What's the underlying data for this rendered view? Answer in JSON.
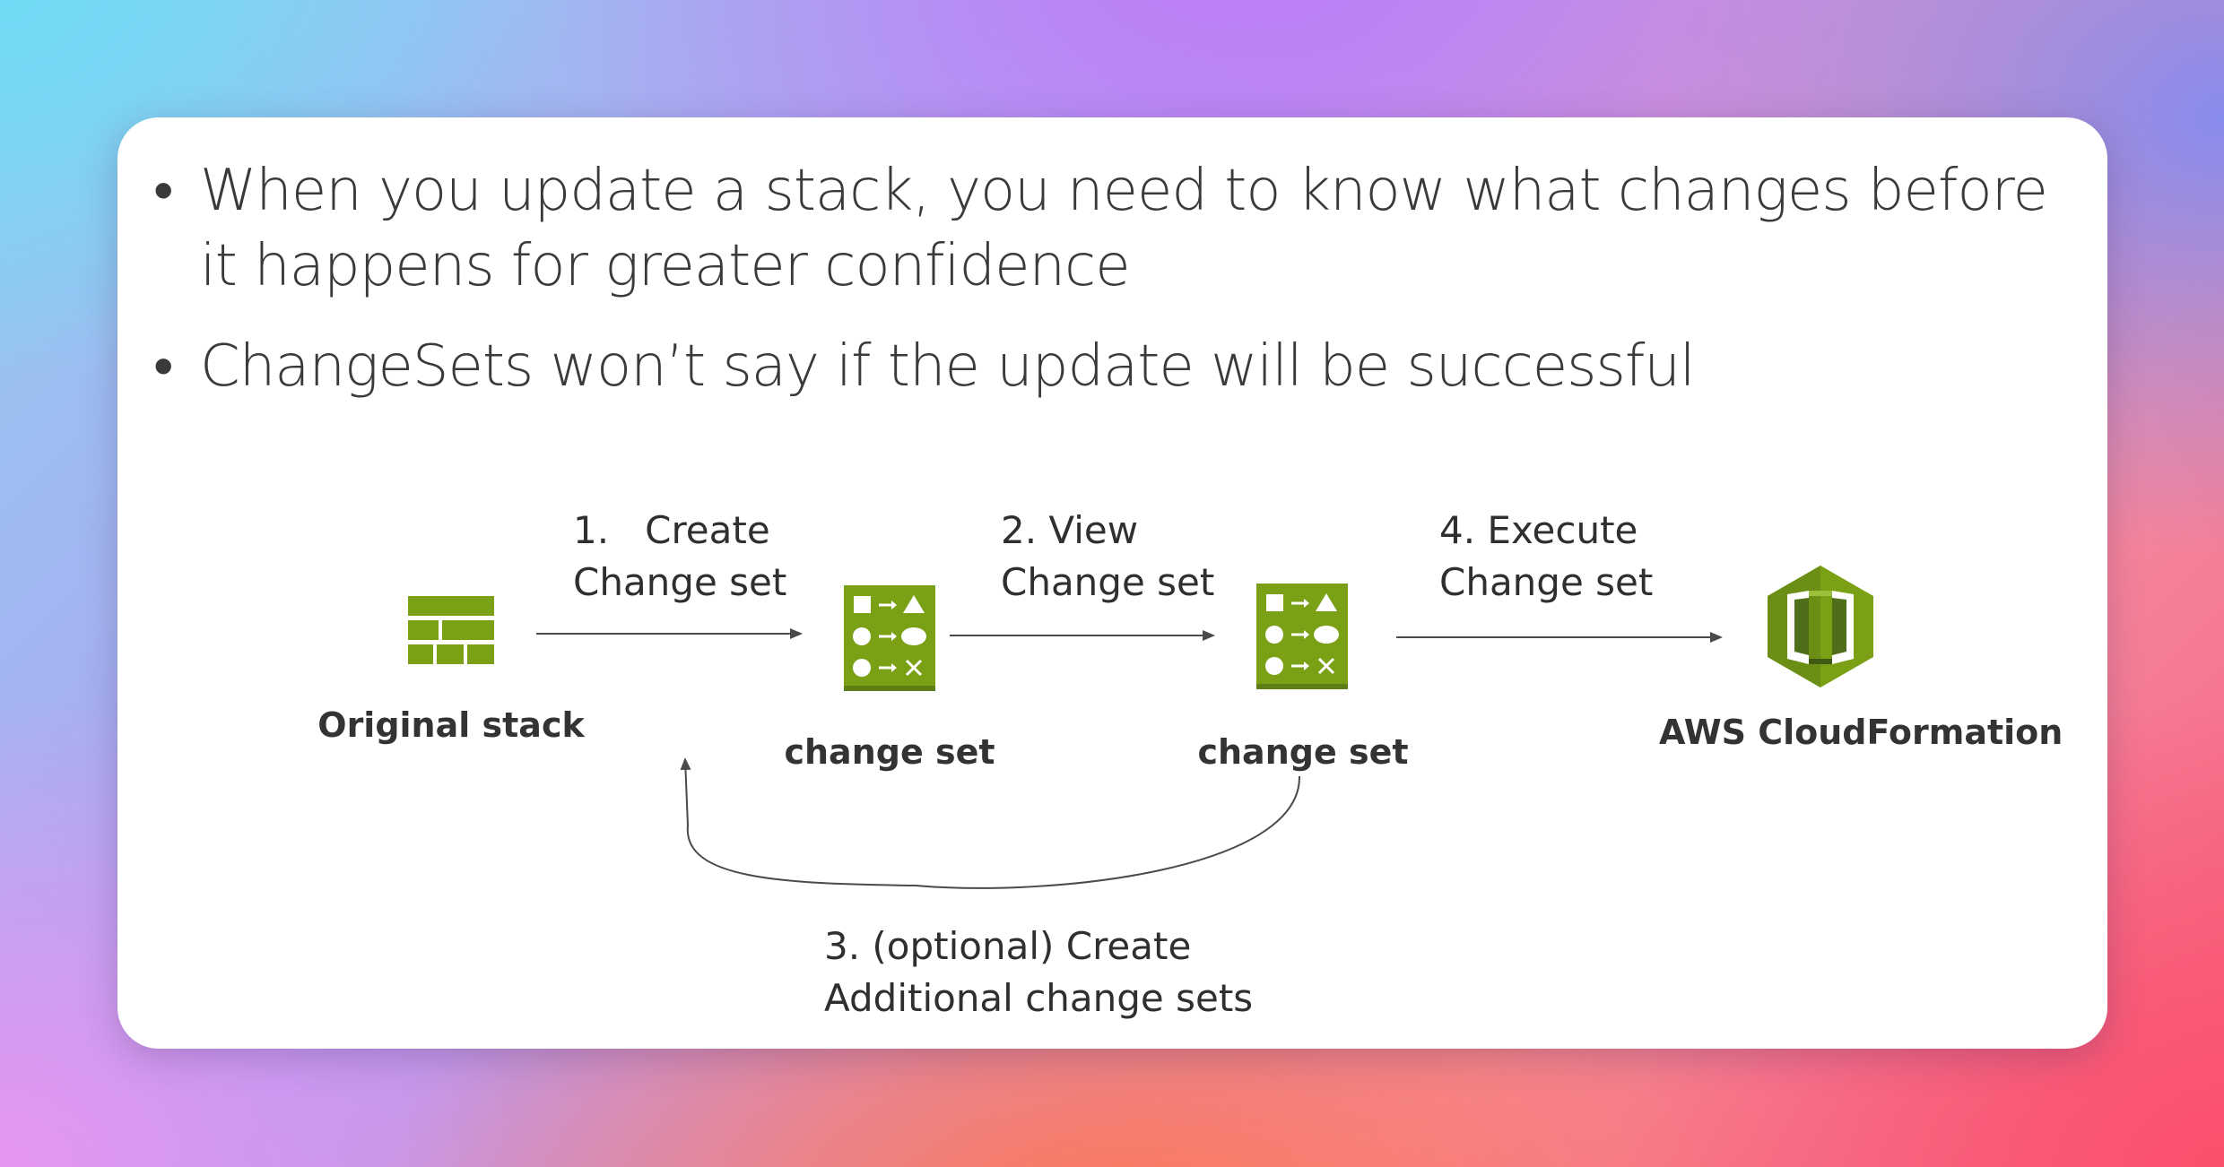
{
  "bullets": [
    "When you update a stack, you need to know what changes before it happens for greater confidence",
    "ChangeSets won’t say if the update will be successful"
  ],
  "steps": {
    "create": {
      "line1": "1.   Create",
      "line2": "Change set"
    },
    "view": {
      "line1": "2. View",
      "line2": "Change set"
    },
    "execute": {
      "line1": "4. Execute",
      "line2": "Change set"
    },
    "optional": {
      "line1": "3. (optional) Create",
      "line2": "Additional change sets"
    }
  },
  "nodes": {
    "original_stack": "Original stack",
    "change_set_1": "change set",
    "change_set_2": "change set",
    "cloudformation": "AWS CloudFormation"
  },
  "colors": {
    "aws_green": "#7aa116",
    "aws_green_dark": "#4f6e1a",
    "aws_green_light": "#9bc13c",
    "arrow": "#4a4a4a"
  },
  "icons": {
    "original_stack": "stack-bricks-icon",
    "change_set": "change-set-icon",
    "cloudformation": "cloudformation-icon"
  }
}
